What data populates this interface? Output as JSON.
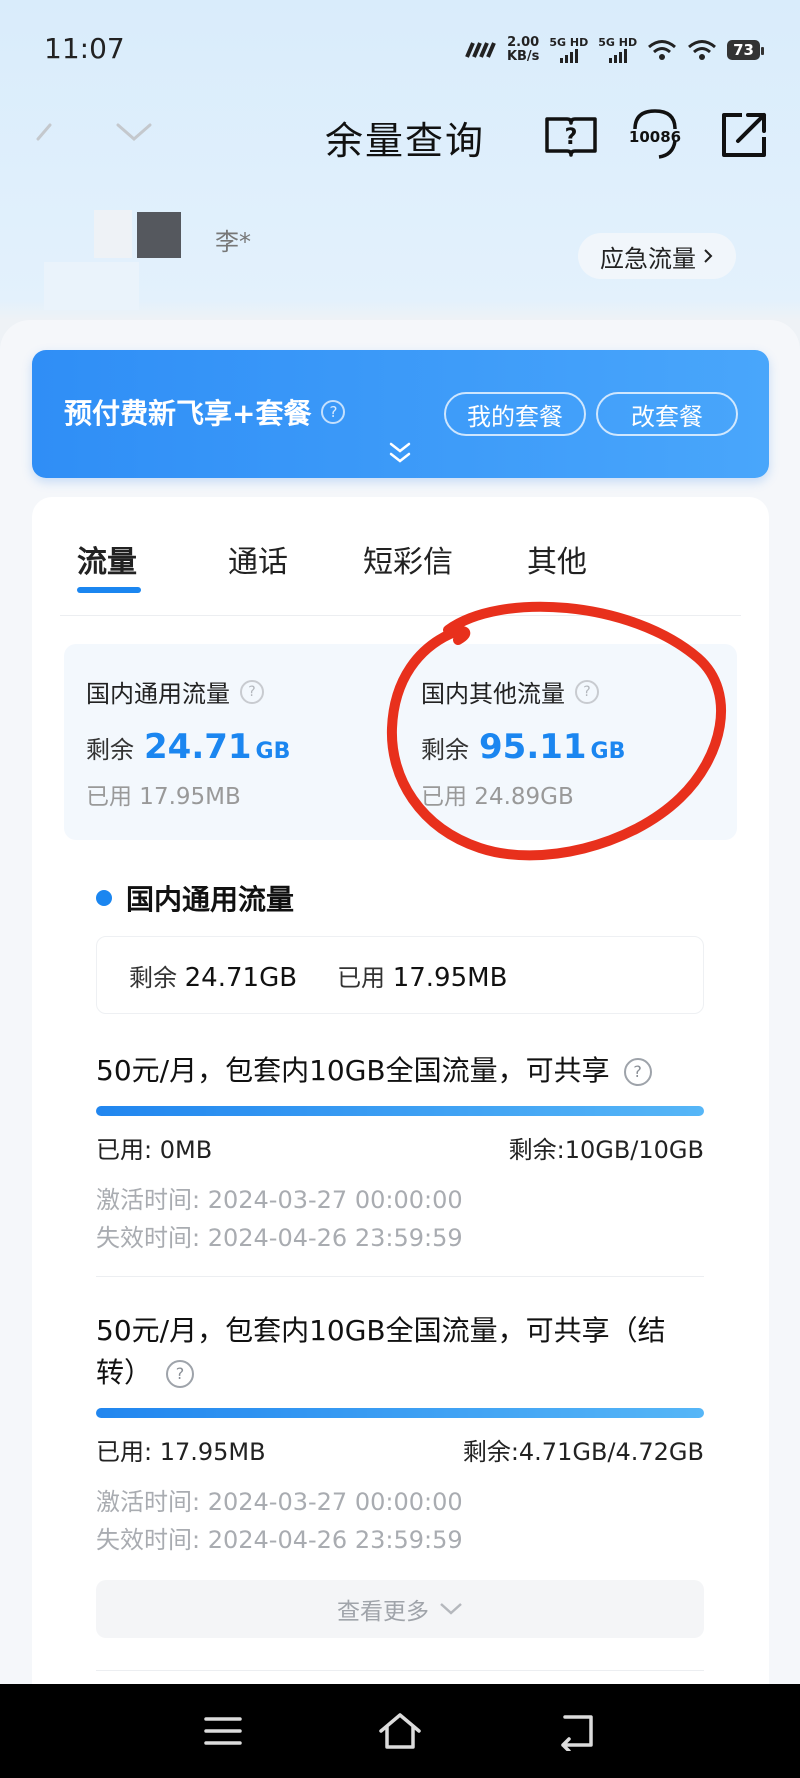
{
  "status_bar": {
    "time": "11:07",
    "speed_value": "2.00",
    "speed_unit": "KB/s",
    "sim1_label": "5G HD",
    "sim2_label": "5G HD",
    "battery": "73"
  },
  "header": {
    "title": "余量查询",
    "service_number": "10086"
  },
  "user": {
    "name": "李*",
    "emergency_label": "应急流量"
  },
  "plan": {
    "name": "预付费新飞享+套餐",
    "my_plan_label": "我的套餐",
    "change_plan_label": "改套餐"
  },
  "tabs": [
    {
      "label": "流量"
    },
    {
      "label": "通话"
    },
    {
      "label": "短彩信"
    },
    {
      "label": "其他"
    }
  ],
  "summary": {
    "general": {
      "title": "国内通用流量",
      "remain_label": "剩余",
      "remain_value": "24.71",
      "remain_unit": "GB",
      "used_text": "已用  17.95MB"
    },
    "other": {
      "title": "国内其他流量",
      "remain_label": "剩余",
      "remain_value": "95.11",
      "remain_unit": "GB",
      "used_text": "已用  24.89GB"
    }
  },
  "section": {
    "title": "国内通用流量",
    "remain_label": "剩余",
    "remain_value": "24.71GB",
    "used_label": "已用",
    "used_value": "17.95MB"
  },
  "packages": [
    {
      "title": "50元/月，包套内10GB全国流量，可共享",
      "used": "已用: 0MB",
      "remain": "剩余:10GB/10GB",
      "activate": "激活时间: 2024-03-27 00:00:00",
      "expire": "失效时间: 2024-04-26 23:59:59"
    },
    {
      "title": "50元/月，包套内10GB全国流量，可共享（结转）",
      "used": "已用: 17.95MB",
      "remain": "剩余:4.71GB/4.72GB",
      "activate": "激活时间: 2024-03-27 00:00:00",
      "expire": "失效时间: 2024-04-26 23:59:59"
    }
  ],
  "more_label": "查看更多",
  "colors": {
    "accent": "#1b86f0",
    "annotation": "#e8301c"
  }
}
